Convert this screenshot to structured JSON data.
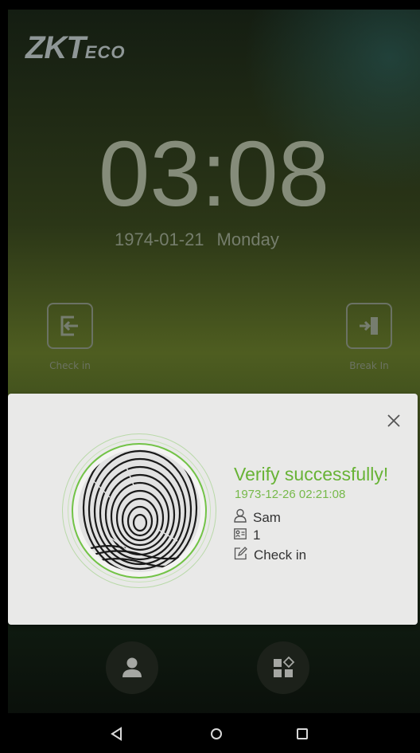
{
  "brand": {
    "logo_main": "ZKT",
    "logo_sub": "eco"
  },
  "clock": {
    "time": "03:08",
    "date": "1974-01-21",
    "weekday": "Monday"
  },
  "shortcuts": {
    "left_label": "Check in",
    "right_label": "Break In"
  },
  "dialog": {
    "status": "Verify successfully!",
    "timestamp": "1973-12-26 02:21:08",
    "user_name": "Sam",
    "user_id": "1",
    "verify_mode": "Check in",
    "accent_color": "#68b336"
  },
  "icons": {
    "close": "close-icon",
    "user": "user-icon",
    "id_card": "id-card-icon",
    "edit": "edit-icon",
    "nav_back": "back-triangle-icon",
    "nav_home": "home-circle-icon",
    "nav_recent": "recent-square-icon"
  }
}
